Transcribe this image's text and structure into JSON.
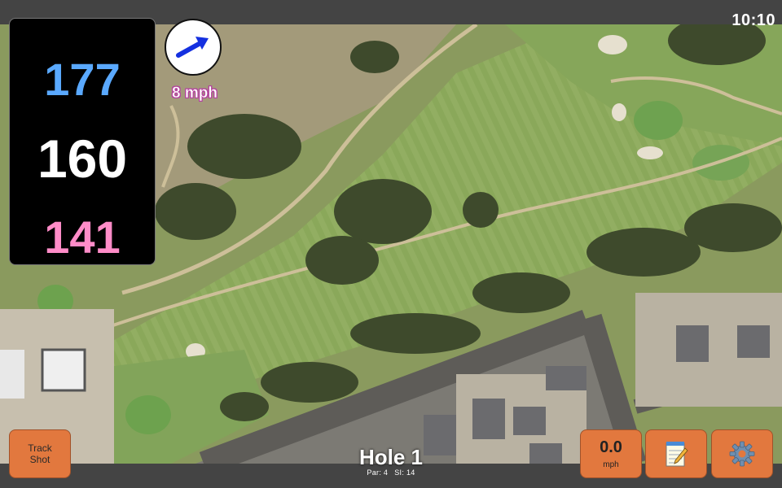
{
  "status_bar": {
    "time": "10:10"
  },
  "distances": {
    "back": "177",
    "middle": "160",
    "front": "141"
  },
  "wind": {
    "speed_label": "8 mph",
    "direction_icon": "arrow-icon"
  },
  "buttons": {
    "track_shot_line1": "Track",
    "track_shot_line2": "Shot",
    "speed_value": "0.0",
    "speed_unit": "mph",
    "notes_icon": "notepad-icon",
    "settings_icon": "gear-icon"
  },
  "hole": {
    "title": "Hole 1",
    "par": "Par: 4",
    "si": "SI: 14"
  },
  "colors": {
    "back_distance": "#5aa9ff",
    "middle_distance": "#ffffff",
    "front_distance": "#ff8cc8",
    "button": "#e2783e",
    "wind_arrow": "#1430e0"
  }
}
